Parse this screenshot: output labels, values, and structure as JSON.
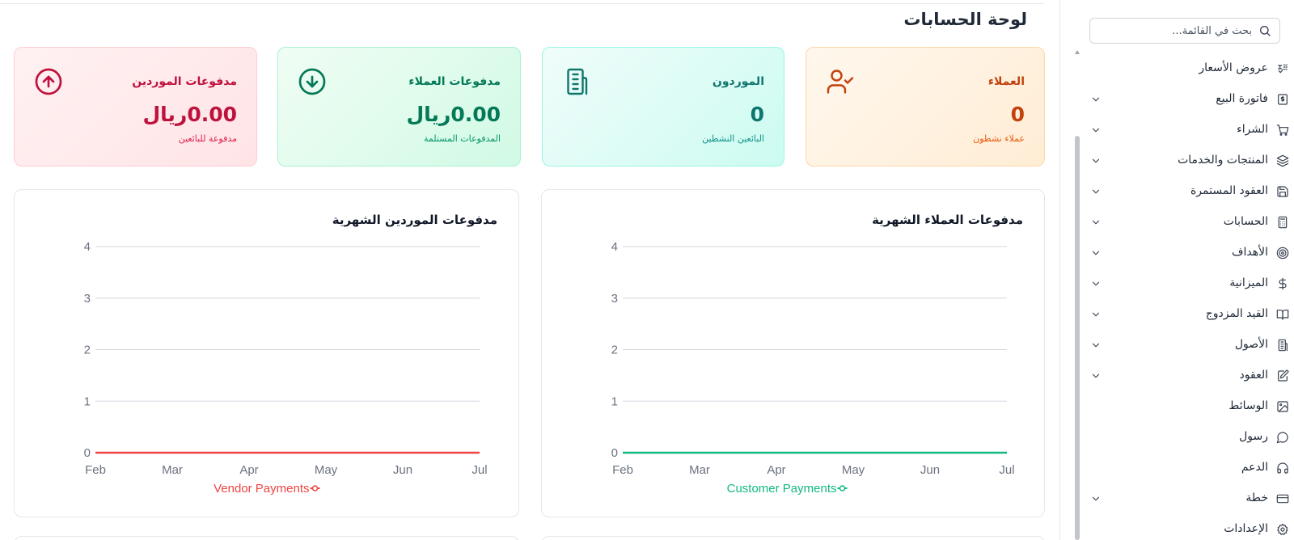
{
  "page": {
    "title": "لوحة الحسابات"
  },
  "colors": {
    "customers": "#c2410c",
    "vendors": "#0f766e",
    "received": "#047857",
    "paid": "#be123c",
    "vendor_line": "#ef4444",
    "customer_line": "#10b981"
  },
  "cards": {
    "customers": {
      "title": "العملاء",
      "value": "0",
      "subtitle": "عملاء نشطون",
      "icon": "user-check-icon"
    },
    "vendors": {
      "title": "الموردون",
      "value": "0",
      "subtitle": "البائعين النشطين",
      "icon": "building-icon"
    },
    "received": {
      "title": "مدفوعات العملاء",
      "value": "0.00ريال",
      "subtitle": "المدفوعات المستلمة",
      "icon": "arrow-down-circle-icon"
    },
    "paid": {
      "title": "مدفوعات الموردين",
      "value": "0.00ريال",
      "subtitle": "مدفوعة للبائعين",
      "icon": "arrow-up-circle-icon"
    }
  },
  "charts": {
    "customer_title": "مدفوعات العملاء الشهرية",
    "vendor_title": "مدفوعات الموردين الشهرية"
  },
  "chart_data": [
    {
      "type": "line",
      "title": "مدفوعات العملاء الشهرية",
      "categories": [
        "Feb",
        "Mar",
        "Apr",
        "May",
        "Jun",
        "Jul"
      ],
      "series": [
        {
          "name": "Customer Payments",
          "values": [
            0,
            0,
            0,
            0,
            0,
            0
          ],
          "color": "#10b981"
        }
      ],
      "yticks": [
        "0",
        "1",
        "2",
        "3",
        "4"
      ],
      "ylim": [
        0,
        4
      ],
      "grid": true,
      "legend": "bottom-center"
    },
    {
      "type": "line",
      "title": "مدفوعات الموردين الشهرية",
      "categories": [
        "Feb",
        "Mar",
        "Apr",
        "May",
        "Jun",
        "Jul"
      ],
      "series": [
        {
          "name": "Vendor Payments",
          "values": [
            0,
            0,
            0,
            0,
            0,
            0
          ],
          "color": "#ef4444"
        }
      ],
      "yticks": [
        "0",
        "1",
        "2",
        "3",
        "4"
      ],
      "ylim": [
        0,
        4
      ],
      "grid": true,
      "legend": "bottom-center"
    }
  ],
  "sidebar": {
    "search_placeholder": "بحث في القائمة...",
    "items": [
      {
        "label": "عروض الأسعار",
        "icon": "quote-icon",
        "has_children": false
      },
      {
        "label": "فاتورة البيع",
        "icon": "invoice-icon",
        "has_children": true
      },
      {
        "label": "الشراء",
        "icon": "cart-icon",
        "has_children": true
      },
      {
        "label": "المنتجات والخدمات",
        "icon": "layers-icon",
        "has_children": true
      },
      {
        "label": "العقود المستمرة",
        "icon": "save-icon",
        "has_children": true
      },
      {
        "label": "الحسابات",
        "icon": "calculator-icon",
        "has_children": true
      },
      {
        "label": "الأهداف",
        "icon": "target-icon",
        "has_children": true
      },
      {
        "label": "الميزانية",
        "icon": "dollar-icon",
        "has_children": true
      },
      {
        "label": "القيد المزدوج",
        "icon": "book-icon",
        "has_children": true
      },
      {
        "label": "الأصول",
        "icon": "building-icon",
        "has_children": true
      },
      {
        "label": "العقود",
        "icon": "edit-document-icon",
        "has_children": true
      },
      {
        "label": "الوسائط",
        "icon": "image-icon",
        "has_children": false
      },
      {
        "label": "رسول",
        "icon": "message-icon",
        "has_children": false
      },
      {
        "label": "الدعم",
        "icon": "headphones-icon",
        "has_children": false
      },
      {
        "label": "خطة",
        "icon": "credit-card-icon",
        "has_children": true
      },
      {
        "label": "الإعدادات",
        "icon": "settings-icon",
        "has_children": false
      }
    ]
  }
}
